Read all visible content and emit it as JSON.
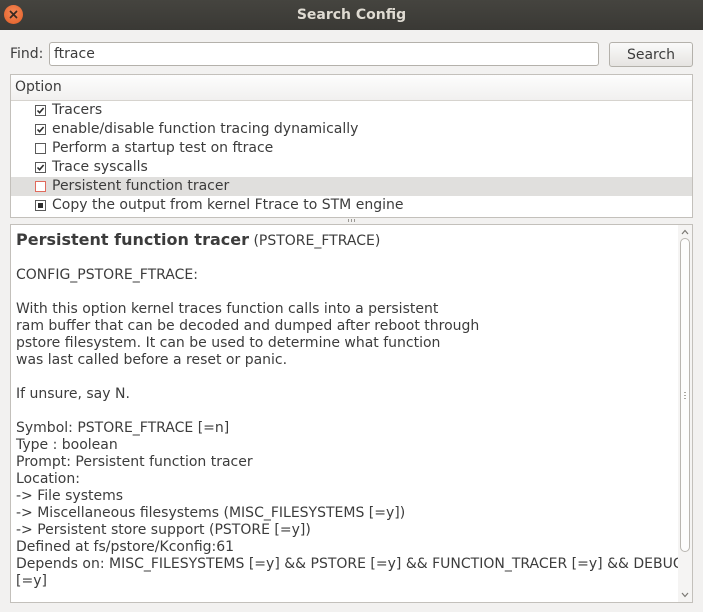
{
  "window": {
    "title": "Search Config"
  },
  "find": {
    "label": "Find:",
    "value": "ftrace",
    "button_label": "Search"
  },
  "tree": {
    "header": "Option",
    "rows": [
      {
        "label": "Tracers",
        "state": "checked"
      },
      {
        "label": "enable/disable function tracing dynamically",
        "state": "checked"
      },
      {
        "label": "Perform a startup test on ftrace",
        "state": "unchecked"
      },
      {
        "label": "Trace syscalls",
        "state": "checked"
      },
      {
        "label": "Persistent function tracer",
        "state": "unchecked",
        "selected": true
      },
      {
        "label": "Copy the output from kernel Ftrace to STM engine",
        "state": "partial"
      }
    ]
  },
  "help": {
    "title": "Persistent function tracer",
    "symbol": "(PSTORE_FTRACE)",
    "config": "CONFIG_PSTORE_FTRACE:",
    "description": [
      "With this option kernel traces function calls into a persistent",
      "ram buffer that can be decoded and dumped after reboot through",
      "pstore filesystem. It can be used to determine what function",
      "was last called before a reset or panic."
    ],
    "unsure": "If unsure, say N.",
    "details": [
      "Symbol: PSTORE_FTRACE [=n]",
      "Type : boolean",
      "Prompt: Persistent function tracer",
      "Location:",
      "-> File systems",
      "-> Miscellaneous filesystems (MISC_FILESYSTEMS [=y])",
      "-> Persistent store support (PSTORE [=y])",
      "Defined at fs/pstore/Kconfig:61",
      "Depends on: MISC_FILESYSTEMS [=y] && PSTORE [=y] && FUNCTION_TRACER [=y] && DEBUG_FS",
      "[=y]"
    ]
  },
  "colors": {
    "titlebar": "#3e3d39",
    "close_button": "#e95420",
    "selected_row": "#e0dfdd"
  }
}
